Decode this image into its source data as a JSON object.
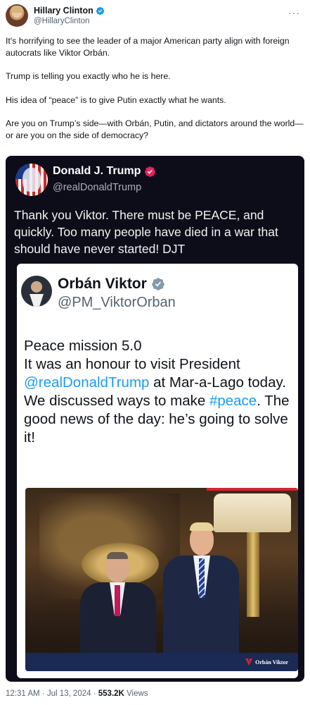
{
  "tweet": {
    "author": {
      "name": "Hillary Clinton",
      "handle": "@HillaryClinton",
      "verified_color": "#1d9bf0"
    },
    "more_icon": "more-dots-icon",
    "paragraphs": [
      "It's horrifying to see the leader of a major American party align with foreign autocrats like Viktor Orbán.",
      "Trump is telling you exactly who he is here.",
      "His idea of “peace” is to give Putin exactly what he wants.",
      "Are you on Trump’s side—with Orbán, Putin, and dictators around the world—or are you on the side of democracy?"
    ],
    "meta": {
      "time": "12:31 AM",
      "date": "Jul 13, 2024",
      "separator": "·",
      "views_count": "553.2K",
      "views_label": "Views"
    }
  },
  "embed": {
    "author": {
      "name": "Donald J. Trump",
      "handle": "@realDonaldTrump",
      "badge_color": "#e0245e"
    },
    "text": "Thank you Viktor. There must be PEACE, and quickly. Too many people have died in a war that should have never started! DJT",
    "inner": {
      "author": {
        "name": "Orbán Viktor",
        "handle": "@PM_ViktorOrban",
        "badge_color": "#829aab"
      },
      "text_parts": {
        "p1": "Peace mission 5.0",
        "p2": "It was an honour to visit President ",
        "link1": "@realDonaldTrump",
        "p3": " at Mar-a-Lago today. We discussed ways to make ",
        "link2": "#peace",
        "p4": ". The good news of the day: he’s going to solve it!"
      },
      "photo_brand": "Orbán Viktor",
      "link_color": "#1d9bf0"
    }
  }
}
